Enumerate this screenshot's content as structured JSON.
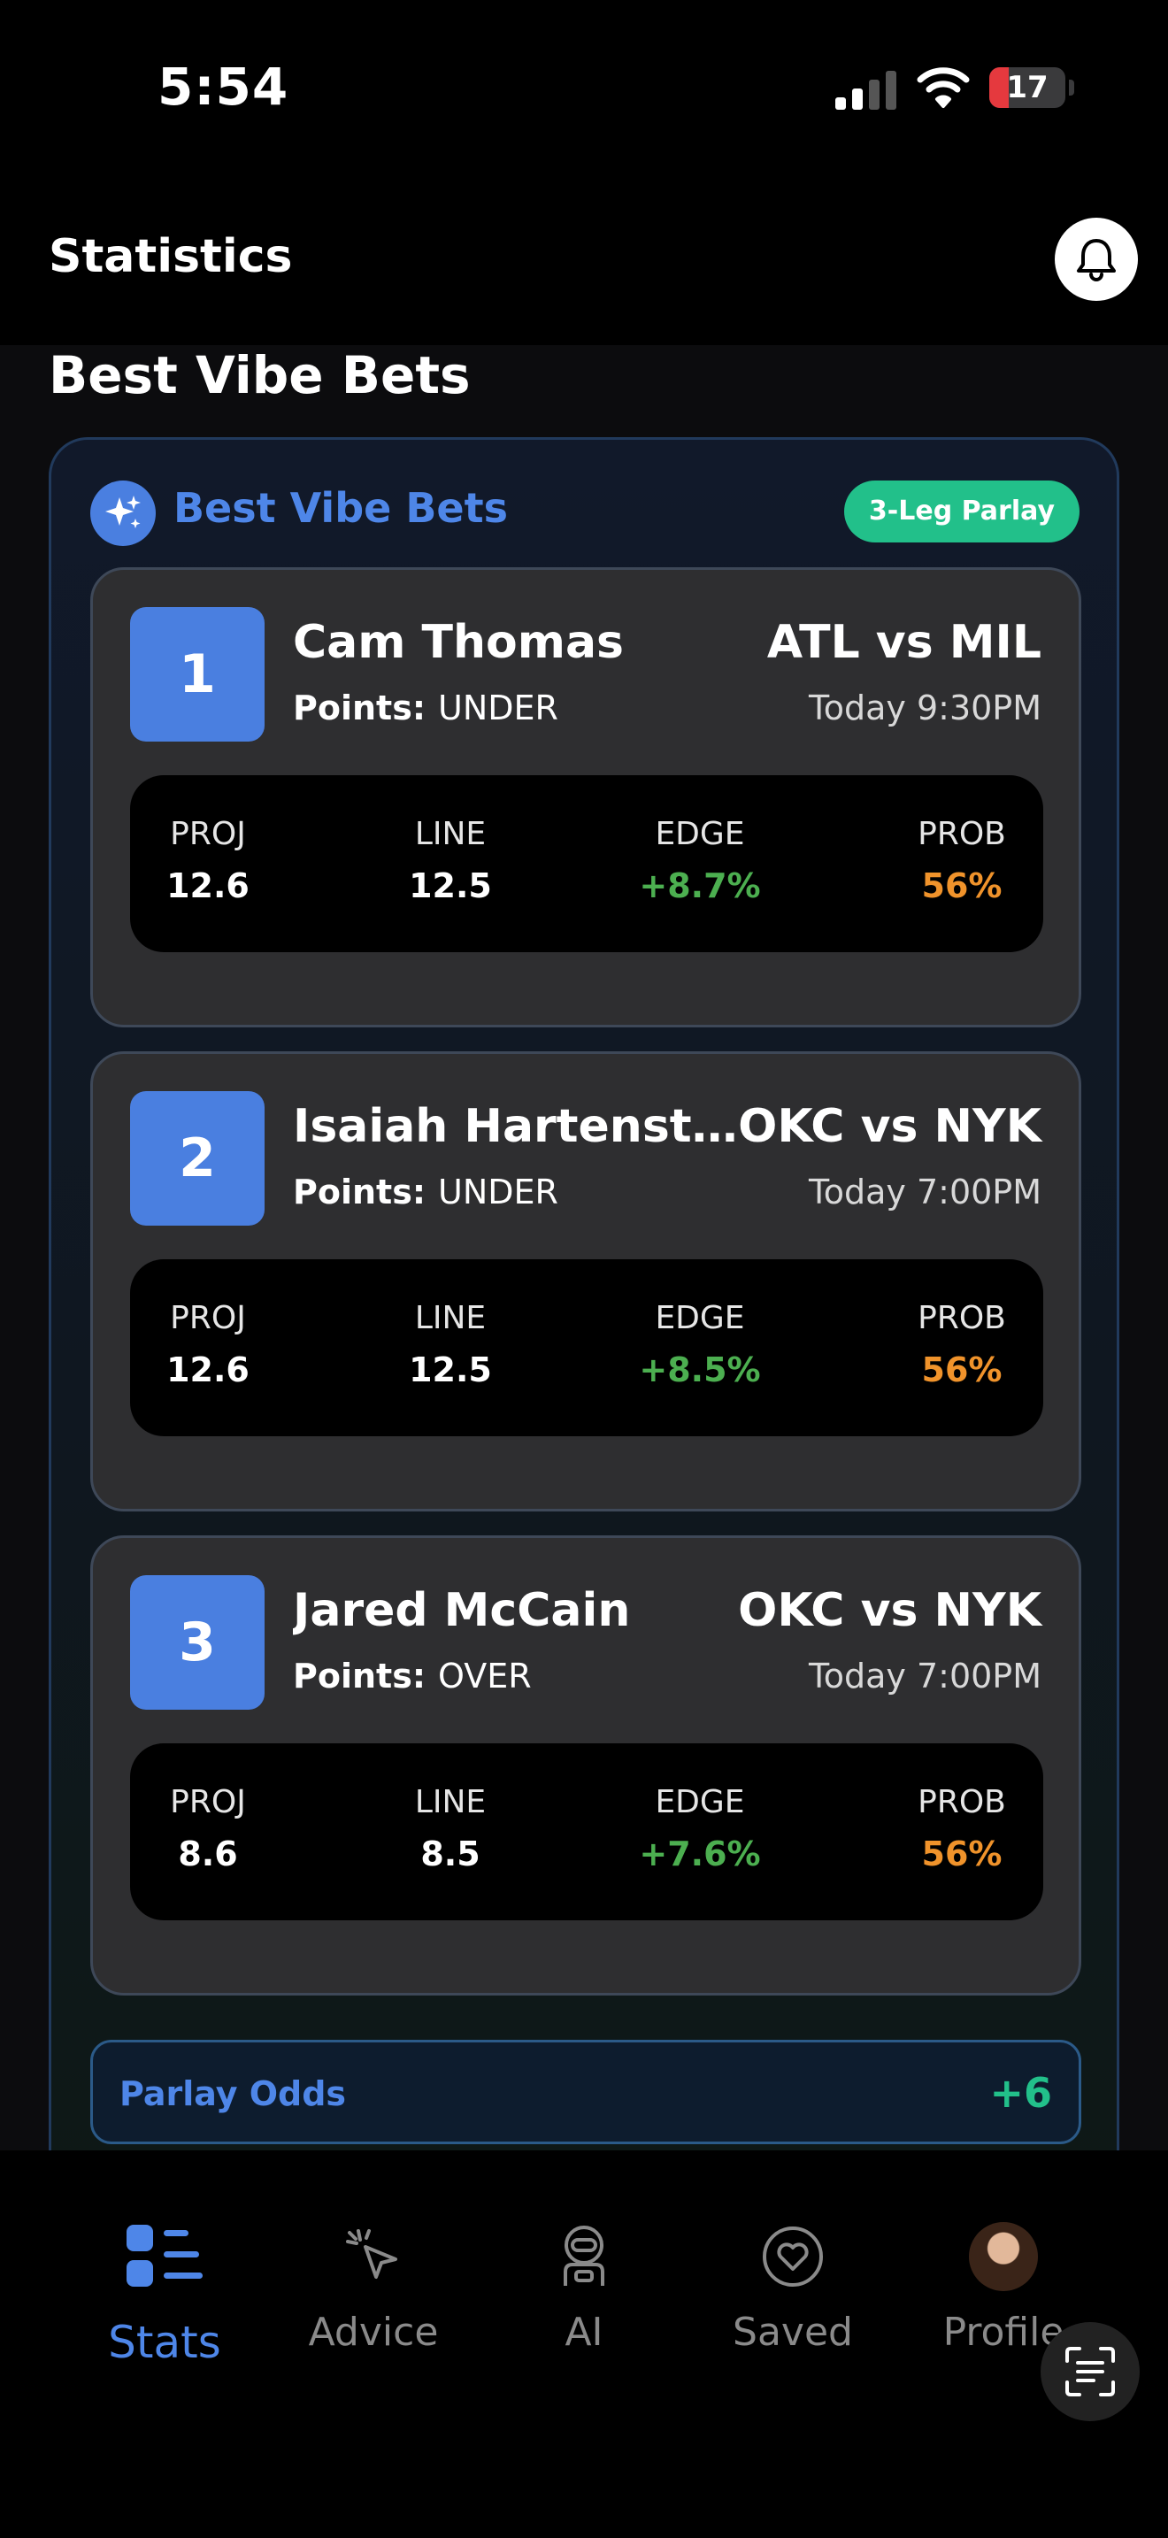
{
  "status_bar": {
    "time": "5:54",
    "battery": "17"
  },
  "header": {
    "title": "Statistics"
  },
  "section_title": "Best Vibe Bets",
  "vibe_card": {
    "title": "Best Vibe Bets",
    "badge": "3-Leg Parlay",
    "bets": [
      {
        "rank": "1",
        "player": "Cam Thomas",
        "market_label": "Points:",
        "pick": "UNDER",
        "matchup": "ATL vs MIL",
        "time": "Today 9:30PM",
        "stats": {
          "proj_label": "PROJ",
          "proj": "12.6",
          "line_label": "LINE",
          "line": "12.5",
          "edge_label": "EDGE",
          "edge": "+8.7%",
          "prob_label": "PROB",
          "prob": "56%"
        }
      },
      {
        "rank": "2",
        "player": "Isaiah Hartenste...",
        "market_label": "Points:",
        "pick": "UNDER",
        "matchup": "OKC vs NYK",
        "time": "Today 7:00PM",
        "stats": {
          "proj_label": "PROJ",
          "proj": "12.6",
          "line_label": "LINE",
          "line": "12.5",
          "edge_label": "EDGE",
          "edge": "+8.5%",
          "prob_label": "PROB",
          "prob": "56%"
        }
      },
      {
        "rank": "3",
        "player": "Jared McCain",
        "market_label": "Points:",
        "pick": "OVER",
        "matchup": "OKC vs NYK",
        "time": "Today 7:00PM",
        "stats": {
          "proj_label": "PROJ",
          "proj": "8.6",
          "line_label": "LINE",
          "line": "8.5",
          "edge_label": "EDGE",
          "edge": "+7.6%",
          "prob_label": "PROB",
          "prob": "56%"
        }
      }
    ],
    "parlay_odds_label": "Parlay Odds",
    "parlay_odds_value": "+6"
  },
  "nav": {
    "items": [
      {
        "label": "Stats",
        "icon": "stats-icon",
        "active": true
      },
      {
        "label": "Advice",
        "icon": "cursor-click-icon"
      },
      {
        "label": "AI",
        "icon": "robot-icon"
      },
      {
        "label": "Saved",
        "icon": "heart-icon"
      },
      {
        "label": "Profile",
        "icon": "avatar"
      }
    ]
  },
  "colors": {
    "accent": "#4e86e8",
    "success": "#22c08a",
    "edge": "#4caf50",
    "prob": "#f0932b"
  }
}
